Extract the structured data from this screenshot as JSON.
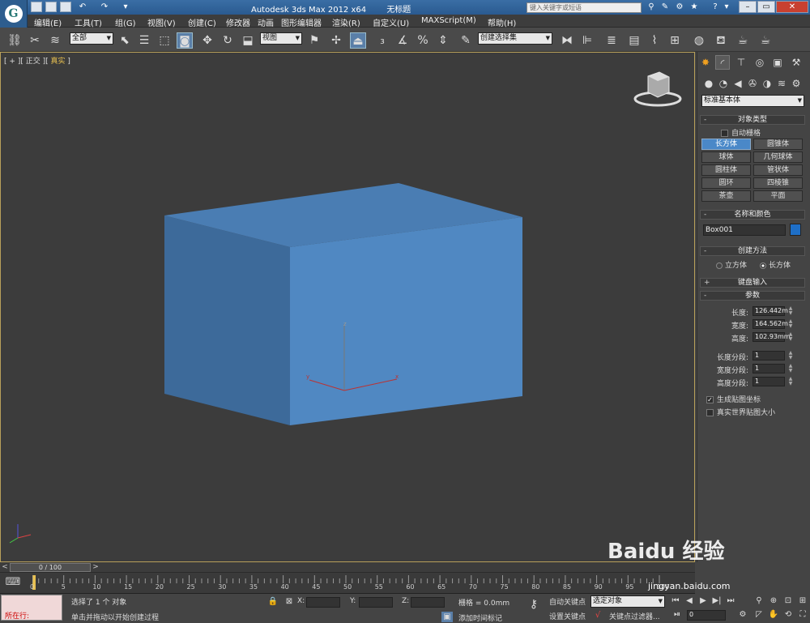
{
  "titlebar": {
    "app_title": "Autodesk 3ds Max  2012 x64",
    "doc_title": "无标题",
    "search_placeholder": "键入关键字或短语"
  },
  "menubar": [
    "编辑(E)",
    "工具(T)",
    "组(G)",
    "视图(V)",
    "创建(C)",
    "修改器",
    "动画",
    "图形编辑器",
    "渲染(R)",
    "自定义(U)",
    "MAXScript(M)",
    "帮助(H)"
  ],
  "toolbar": {
    "selection_filter": "全部",
    "ref_coord": "视图",
    "named_selection": "创建选择集"
  },
  "viewport": {
    "bracket_open": "[",
    "plus": "+",
    "view_name": "正交",
    "shading": "真实",
    "bracket_close": "]",
    "box_color": "#4f86c0",
    "axis_x": "x",
    "axis_y": "y",
    "axis_z": "z"
  },
  "cmdpanel": {
    "category": "标准基本体",
    "object_type": {
      "title": "对象类型",
      "autogrid": "自动栅格",
      "buttons": [
        "长方体",
        "圆锥体",
        "球体",
        "几何球体",
        "圆柱体",
        "管状体",
        "圆环",
        "四棱锥",
        "茶壶",
        "平面"
      ],
      "active": "长方体"
    },
    "name_color": {
      "title": "名称和颜色",
      "name": "Box001",
      "swatch": "#1e6fc8"
    },
    "creation_method": {
      "title": "创建方法",
      "cube": "立方体",
      "box": "长方体"
    },
    "keyboard_entry": {
      "title": "键盘输入"
    },
    "params": {
      "title": "参数",
      "length_label": "长度:",
      "length": "126.442m",
      "width_label": "宽度:",
      "width": "164.562m",
      "height_label": "高度:",
      "height": "102.93mm",
      "length_segs_label": "长度分段:",
      "length_segs": "1",
      "width_segs_label": "宽度分段:",
      "width_segs": "1",
      "height_segs_label": "高度分段:",
      "height_segs": "1",
      "gen_map_coords": "生成贴图坐标",
      "real_world": "真实世界贴图大小"
    },
    "plus": "+",
    "minus": "-"
  },
  "timeline": {
    "slider_text": "0 / 100",
    "prev": "<",
    "next": ">",
    "ticks": [
      "0",
      "5",
      "10",
      "15",
      "20",
      "25",
      "30",
      "35",
      "40",
      "45",
      "50",
      "55",
      "60",
      "65",
      "70",
      "75",
      "80",
      "85",
      "90",
      "95",
      "100"
    ]
  },
  "status": {
    "maxscript_text": "所在行:",
    "selected": "选择了 1 个 对象",
    "prompt": "单击并拖动以开始创建过程",
    "x_label": "X:",
    "y_label": "Y:",
    "z_label": "Z:",
    "grid": "栅格 = 0.0mm",
    "add_time_tag": "添加时间标记",
    "autokey": "自动关键点",
    "setkey": "设置关键点",
    "selected_obj": "选定对象",
    "key_filters": "关键点过滤器...",
    "frame": "0"
  },
  "watermark": {
    "text": "Baidu 经验",
    "url": "jingyan.baidu.com"
  }
}
